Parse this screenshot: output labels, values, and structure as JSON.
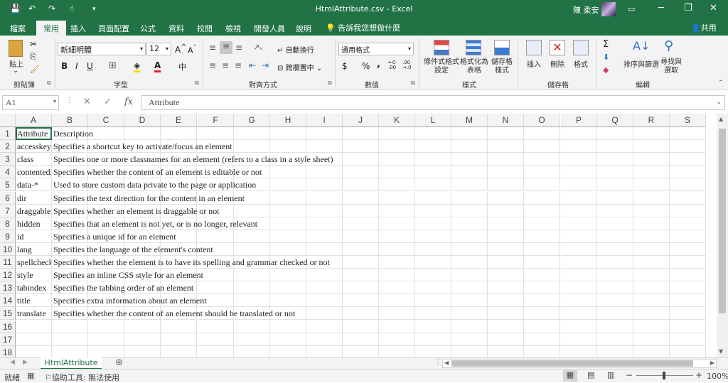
{
  "window": {
    "title": "HtmlAttribute.csv  -  Excel",
    "user": "陳 柔安",
    "controls": {
      "minimize": "─",
      "restore": "❐",
      "close": "✕"
    }
  },
  "quick_access": {
    "save": "💾",
    "undo": "↶",
    "redo": "↷",
    "touch": "☝",
    "more": "▾"
  },
  "tabs": [
    "檔案",
    "常用",
    "插入",
    "頁面配置",
    "公式",
    "資料",
    "校閱",
    "檢視",
    "開發人員",
    "說明"
  ],
  "active_tab": "常用",
  "tell_me": "告訴我您想做什麼",
  "share": "共用",
  "ribbon": {
    "clipboard": {
      "label": "剪貼簿",
      "paste": "貼上"
    },
    "font": {
      "label": "字型",
      "name": "新細明體",
      "size": "12",
      "bold": "B",
      "italic": "I",
      "underline": "U"
    },
    "alignment": {
      "label": "對齊方式",
      "wrap": "自動換行",
      "merge": "跨欄置中"
    },
    "number": {
      "label": "數值",
      "format": "通用格式",
      "currency": "$",
      "percent": "%",
      "comma": ","
    },
    "styles": {
      "label": "樣式",
      "conditional": "條件式格式\n設定",
      "as_table": "格式化為\n表格",
      "cell_styles": "儲存格\n樣式"
    },
    "cells": {
      "label": "儲存格",
      "insert": "插入",
      "delete": "刪除",
      "format": "格式"
    },
    "editing": {
      "label": "編輯",
      "sort": "排序與篩選",
      "find": "尋找與\n選取"
    }
  },
  "formula_bar": {
    "name_box": "A1",
    "fx": "fx",
    "value": "Attribute"
  },
  "columns": [
    "A",
    "B",
    "C",
    "D",
    "E",
    "F",
    "G",
    "H",
    "I",
    "J",
    "K",
    "L",
    "M",
    "N",
    "O",
    "P",
    "Q",
    "R",
    "S"
  ],
  "rows": [
    [
      "Attribute",
      "Description"
    ],
    [
      "accesskey",
      "Specifies a shortcut key to activate/focus an element"
    ],
    [
      "class",
      "Specifies one or more classnames for an element (refers to a class in a style sheet)"
    ],
    [
      "contentedi",
      "Specifies whether the content of an element is editable or not"
    ],
    [
      "data-*",
      "Used to store custom data private to the page or application"
    ],
    [
      "dir",
      "Specifies the text direction for the content in an element"
    ],
    [
      "draggable",
      "Specifies whether an element is draggable or not"
    ],
    [
      "hidden",
      "Specifies that an element is not yet, or is no longer, relevant"
    ],
    [
      "id",
      "Specifies a unique id for an element"
    ],
    [
      "lang",
      "Specifies the language of the element's content"
    ],
    [
      "spellcheck",
      "Specifies whether the element is to have its spelling and grammar checked or not"
    ],
    [
      "style",
      "Specifies an inline CSS style for an element"
    ],
    [
      "tabindex",
      "Specifies the tabbing order of an element"
    ],
    [
      "title",
      "Specifies extra information about an element"
    ],
    [
      "translate",
      "Specifies whether the content of an element should be translated or not"
    ],
    [
      "",
      ""
    ],
    [
      "",
      ""
    ],
    [
      "",
      ""
    ]
  ],
  "sheet_tab": "HtmlAttribute",
  "status": {
    "ready": "就緒",
    "accessibility": "協助工具: 無法使用",
    "zoom": "100%"
  },
  "colors": {
    "brand": "#217346"
  }
}
